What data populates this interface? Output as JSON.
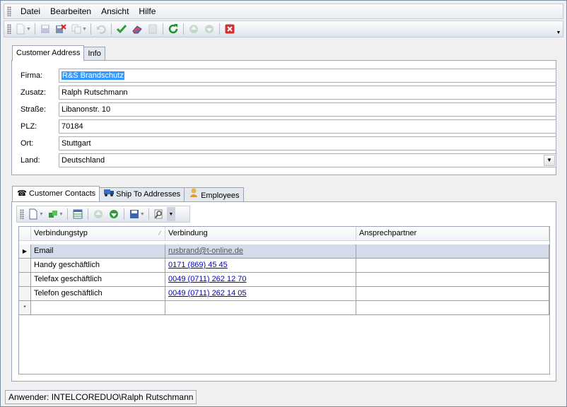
{
  "menu": [
    "Datei",
    "Bearbeiten",
    "Ansicht",
    "Hilfe"
  ],
  "toolbar_icons": [
    "new-icon",
    "save-icon",
    "delete-icon",
    "copy-icon",
    "undo-icon",
    "accept-icon",
    "eraser-icon",
    "print-icon",
    "refresh-icon",
    "up-icon",
    "down-icon",
    "cancel-icon"
  ],
  "address_tabs": [
    "Customer Address",
    "Info"
  ],
  "form": {
    "firma": {
      "label": "Firma:",
      "value": "R&S Brandschutz"
    },
    "zusatz": {
      "label": "Zusatz:",
      "value": "Ralph Rutschmann"
    },
    "strasse": {
      "label": "Straße:",
      "value": "Libanonstr. 10"
    },
    "plz": {
      "label": "PLZ:",
      "value": "70184"
    },
    "ort": {
      "label": "Ort:",
      "value": "Stuttgart"
    },
    "land": {
      "label": "Land:",
      "value": "Deutschland"
    }
  },
  "bottom_tabs": [
    {
      "label": "Customer Contacts",
      "icon": "telephone-icon"
    },
    {
      "label": "Ship To Addresses",
      "icon": "truck-icon"
    },
    {
      "label": "Employees",
      "icon": "person-icon"
    }
  ],
  "grid": {
    "columns": [
      "Verbindungstyp",
      "Verbindung",
      "Ansprechpartner"
    ],
    "rows": [
      {
        "typ": "Email",
        "verbindung": "rusbrand@t-online.de",
        "partner": ""
      },
      {
        "typ": "Handy geschäftlich",
        "verbindung": "0171 (869) 45 45",
        "partner": ""
      },
      {
        "typ": "Telefax geschäftlich",
        "verbindung": "0049 (0711) 262 12 70",
        "partner": ""
      },
      {
        "typ": "Telefon geschäftlich",
        "verbindung": "0049 (0711) 262 14 05",
        "partner": ""
      }
    ],
    "new_row_marker": "*"
  },
  "status": {
    "user_text": "Anwender: INTELCOREDUO\\Ralph Rutschmann"
  },
  "colors": {
    "accent_green": "#2f9e3a",
    "refresh_green": "#1f8f2a",
    "cancel_red": "#d33030",
    "selection": "#d4dcea",
    "link": "#0000cc"
  }
}
